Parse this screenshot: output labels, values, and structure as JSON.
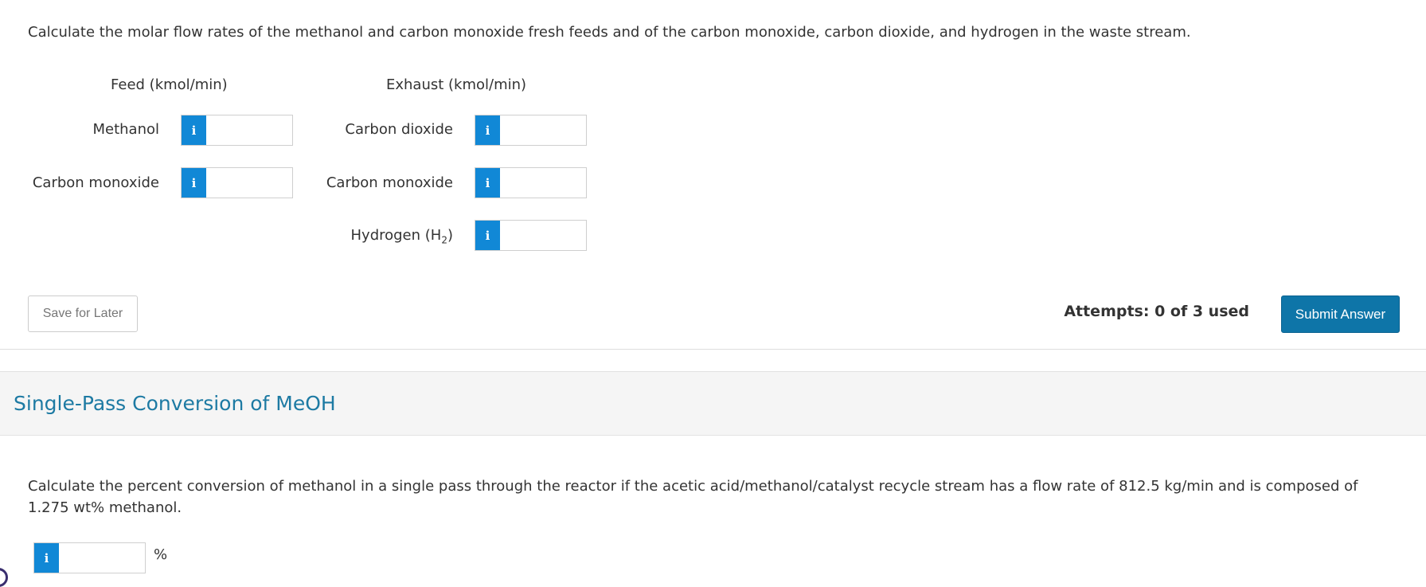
{
  "question1": {
    "text": "Calculate the molar flow rates of the methanol and carbon monoxide fresh feeds and of the carbon monoxide, carbon dioxide, and hydrogen in the waste stream.",
    "feed_header": "Feed (kmol/min)",
    "exhaust_header": "Exhaust (kmol/min)",
    "feed_rows": [
      {
        "label": "Methanol",
        "value": ""
      },
      {
        "label": "Carbon monoxide",
        "value": ""
      }
    ],
    "exhaust_rows": [
      {
        "label": "Carbon dioxide",
        "value": ""
      },
      {
        "label": "Carbon monoxide",
        "value": ""
      },
      {
        "label_main": "Hydrogen (H",
        "label_sub": "2",
        "label_end": ")",
        "value": ""
      }
    ],
    "info_glyph": "i"
  },
  "actions": {
    "save_label": "Save for Later",
    "attempts_text": "Attempts: 0 of 3 used",
    "submit_label": "Submit Answer",
    "submit_color": "#0e75a8"
  },
  "section2": {
    "title": "Single-Pass Conversion of MeOH",
    "title_color": "#1d7aa3",
    "text": "Calculate the percent conversion of methanol in a single pass through the reactor if the acetic acid/methanol/catalyst recycle stream has a flow rate of 812.5 kg/min and is composed of 1.275 wt% methanol.",
    "answer_value": "",
    "unit": "%"
  },
  "icons": {
    "info": "info-icon"
  }
}
